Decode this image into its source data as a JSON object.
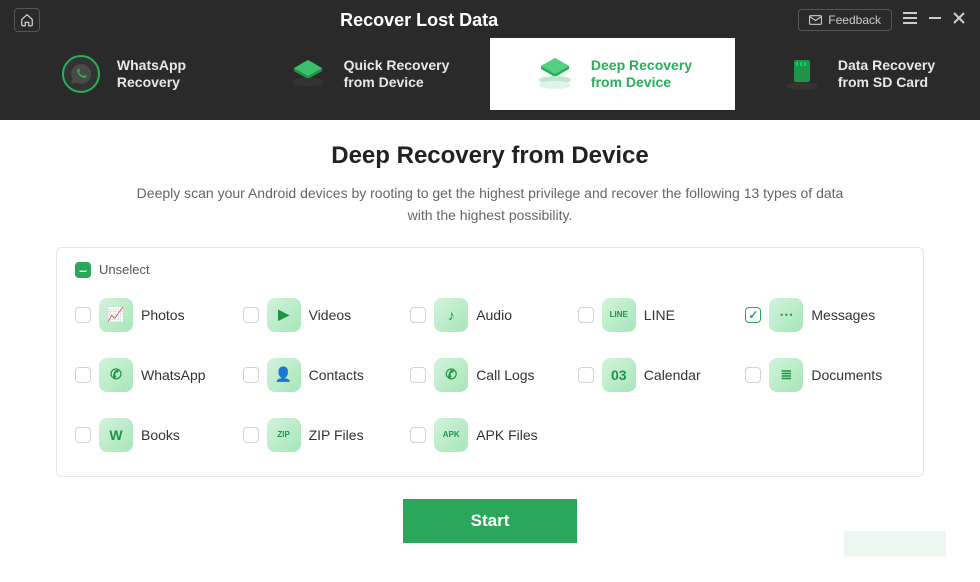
{
  "titlebar": {
    "title": "Recover Lost Data",
    "feedback": "Feedback"
  },
  "tabs": [
    {
      "line1": "WhatsApp",
      "line2": "Recovery",
      "icon": "whatsapp-recovery-icon"
    },
    {
      "line1": "Quick Recovery",
      "line2": "from Device",
      "icon": "quick-recovery-icon"
    },
    {
      "line1": "Deep Recovery",
      "line2": "from Device",
      "icon": "deep-recovery-icon",
      "active": true
    },
    {
      "line1": "Data Recovery",
      "line2": "from SD Card",
      "icon": "sd-card-icon"
    }
  ],
  "main": {
    "heading": "Deep Recovery from Device",
    "subtitle": "Deeply scan your Android devices by rooting to get the highest privilege and recover the following 13 types of data with the highest possibility."
  },
  "panel": {
    "unselect_label": "Unselect"
  },
  "items": [
    {
      "label": "Photos",
      "glyph": "📈",
      "icon": "photos-icon",
      "checked": false
    },
    {
      "label": "Videos",
      "glyph": "▶",
      "icon": "videos-icon",
      "checked": false
    },
    {
      "label": "Audio",
      "glyph": "♪",
      "icon": "audio-icon",
      "checked": false
    },
    {
      "label": "LINE",
      "glyph": "LINE",
      "icon": "line-icon",
      "checked": false
    },
    {
      "label": "Messages",
      "glyph": "⋯",
      "icon": "messages-icon",
      "checked": true
    },
    {
      "label": "WhatsApp",
      "glyph": "✆",
      "icon": "whatsapp-icon",
      "checked": false
    },
    {
      "label": "Contacts",
      "glyph": "👤",
      "icon": "contacts-icon",
      "checked": false
    },
    {
      "label": "Call Logs",
      "glyph": "✆",
      "icon": "calllogs-icon",
      "checked": false
    },
    {
      "label": "Calendar",
      "glyph": "03",
      "icon": "calendar-icon",
      "checked": false
    },
    {
      "label": "Documents",
      "glyph": "≣",
      "icon": "documents-icon",
      "checked": false
    },
    {
      "label": "Books",
      "glyph": "W",
      "icon": "books-icon",
      "checked": false
    },
    {
      "label": "ZIP Files",
      "glyph": "ZIP",
      "icon": "zipfiles-icon",
      "checked": false
    },
    {
      "label": "APK Files",
      "glyph": "APK",
      "icon": "apkfiles-icon",
      "checked": false
    }
  ],
  "actions": {
    "start": "Start"
  },
  "colors": {
    "brand_green": "#2aa75a",
    "header_bg": "#2a2a2a"
  }
}
